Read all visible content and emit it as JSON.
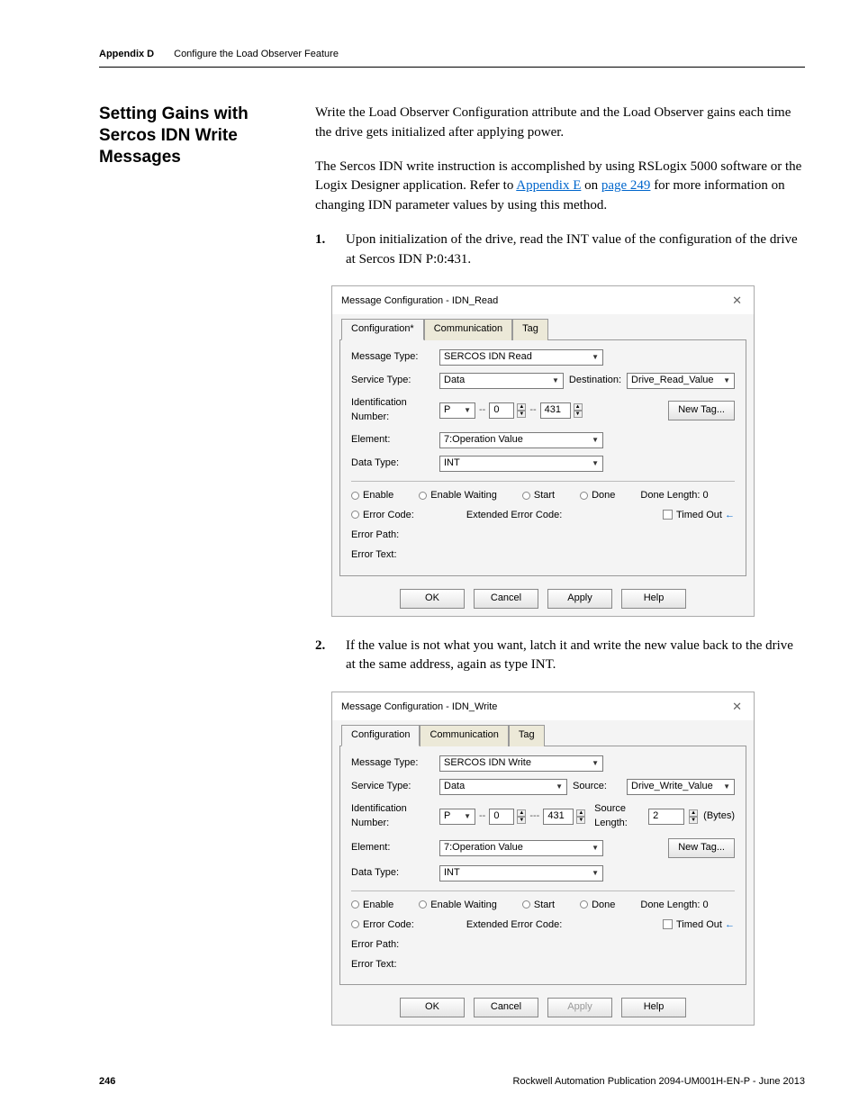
{
  "header": {
    "appendix_label": "Appendix D",
    "chapter_title": "Configure the Load Observer Feature"
  },
  "section_heading": "Setting Gains with Sercos IDN Write Messages",
  "intro_p1": "Write the Load Observer Configuration attribute and the Load Observer gains each time the drive gets initialized after applying power.",
  "intro_p2a": "The Sercos IDN write instruction is accomplished by using RSLogix 5000 software or the Logix Designer application. Refer to ",
  "link_appendix": "Appendix E",
  "intro_p2b": " on ",
  "link_page": "page 249",
  "intro_p2c": " for more information on changing IDN parameter values by using this method.",
  "step1": {
    "num": "1.",
    "text": "Upon initialization of the drive, read the INT value of the configuration of the drive at Sercos IDN P:0:431."
  },
  "step2": {
    "num": "2.",
    "text": "If the value is not what you want, latch it and write the new value back to the drive at the same address, again as type INT."
  },
  "dlg_read": {
    "title": "Message Configuration - IDN_Read",
    "tabs": {
      "config": "Configuration*",
      "comm": "Communication",
      "tag": "Tag"
    },
    "labels": {
      "msg_type": "Message Type:",
      "svc_type": "Service Type:",
      "idn": "Identification Number:",
      "element": "Element:",
      "data_type": "Data Type:",
      "dest": "Destination:"
    },
    "values": {
      "msg_type": "SERCOS IDN Read",
      "svc_type": "Data",
      "idn_p": "P",
      "idn_a": "0",
      "idn_b": "431",
      "element": "7:Operation Value",
      "data_type": "INT",
      "dest": "Drive_Read_Value"
    },
    "new_tag": "New Tag...",
    "status": {
      "enable": "Enable",
      "enable_wait": "Enable Waiting",
      "start": "Start",
      "done": "Done",
      "done_len": "Done Length: 0",
      "err_code": "Error Code:",
      "ext_err": "Extended Error Code:",
      "timed_out": "Timed Out",
      "err_path": "Error Path:",
      "err_text": "Error Text:"
    }
  },
  "dlg_write": {
    "title": "Message Configuration - IDN_Write",
    "tabs": {
      "config": "Configuration",
      "comm": "Communication",
      "tag": "Tag"
    },
    "labels": {
      "msg_type": "Message Type:",
      "svc_type": "Service Type:",
      "idn": "Identification Number:",
      "element": "Element:",
      "data_type": "Data Type:",
      "source": "Source:",
      "src_len": "Source Length:"
    },
    "values": {
      "msg_type": "SERCOS IDN Write",
      "svc_type": "Data",
      "idn_p": "P",
      "idn_a": "0",
      "idn_b": "431",
      "element": "7:Operation Value",
      "data_type": "INT",
      "source": "Drive_Write_Value",
      "src_len": "2",
      "bytes": "(Bytes)"
    },
    "new_tag": "New Tag...",
    "status": {
      "enable": "Enable",
      "enable_wait": "Enable Waiting",
      "start": "Start",
      "done": "Done",
      "done_len": "Done Length: 0",
      "err_code": "Error Code:",
      "ext_err": "Extended Error Code:",
      "timed_out": "Timed Out",
      "err_path": "Error Path:",
      "err_text": "Error Text:"
    }
  },
  "buttons": {
    "ok": "OK",
    "cancel": "Cancel",
    "apply": "Apply",
    "help": "Help"
  },
  "footer": {
    "page": "246",
    "pub": "Rockwell Automation Publication 2094-UM001H-EN-P - June 2013"
  }
}
